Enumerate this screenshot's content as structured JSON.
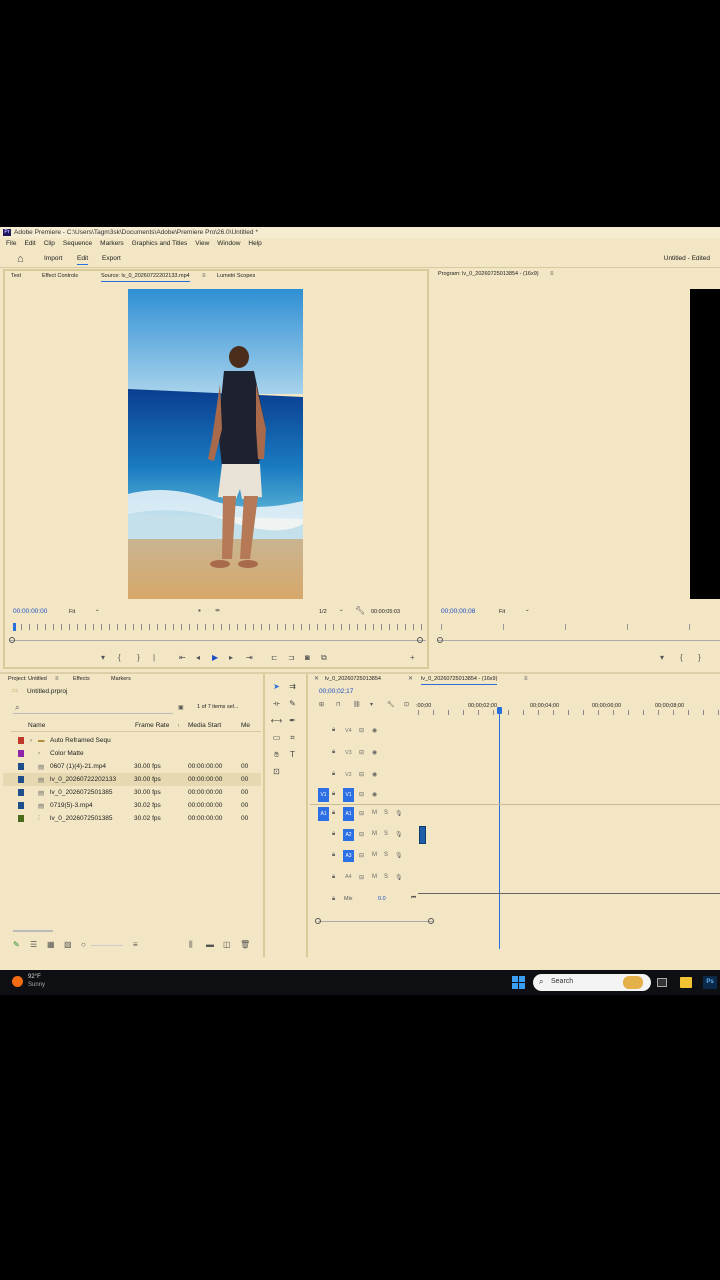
{
  "titlebar": {
    "logo": "Pr",
    "text": "Adobe Premiere - C:\\Users\\Tagm3sk\\Documents\\Adobe\\Premiere Pro\\26.0\\Untitled *"
  },
  "menu": [
    "File",
    "Edit",
    "Clip",
    "Sequence",
    "Markers",
    "Graphics and Titles",
    "View",
    "Window",
    "Help"
  ],
  "nav": {
    "import": "Import",
    "edit": "Edit",
    "export": "Export",
    "project_status": "Untitled - Edited"
  },
  "source_panel": {
    "tabs": [
      "Text",
      "Effect Controls",
      "Source: lv_0_20260722202133.mp4",
      "Lumetri Scopes"
    ],
    "timecode_left": "00:00:00:00",
    "fit": "Fit",
    "resolution": "1/2",
    "timecode_right": "00:00:05:03"
  },
  "program_panel": {
    "title": "Program: lv_0_20260725013854 - (16x9)",
    "timecode": "00;00;00;08",
    "fit": "Fit"
  },
  "project_panel": {
    "tabs": [
      "Project: Untitled",
      "Effects",
      "Markers"
    ],
    "file": "Untitled.prproj",
    "selection_count": "1 of 7 items sel...",
    "columns": {
      "name": "Name",
      "frame_rate": "Frame Rate",
      "media_start": "Media Start",
      "more": "Me"
    },
    "items": [
      {
        "color": "#c0392b",
        "name": "Auto Reframed Sequ",
        "fps": "",
        "start": "",
        "extra": "",
        "kind": "folder"
      },
      {
        "color": "#8e24aa",
        "name": "Color Matte",
        "fps": "",
        "start": "",
        "extra": "",
        "kind": "matte"
      },
      {
        "color": "#1f4e8c",
        "name": "0607 (1)(4)-21.mp4",
        "fps": "30.00 fps",
        "start": "00:00:00:00",
        "extra": "00",
        "kind": "clip"
      },
      {
        "color": "#1f4e8c",
        "name": "lv_0_20260722202133",
        "fps": "30.00 fps",
        "start": "00:00:00:00",
        "extra": "00",
        "kind": "clip"
      },
      {
        "color": "#1f4e8c",
        "name": "lv_0_2026072501385",
        "fps": "30.00 fps",
        "start": "00:00:00:00",
        "extra": "00",
        "kind": "clip"
      },
      {
        "color": "#1f4e8c",
        "name": "0719(5)-3.mp4",
        "fps": "30.02 fps",
        "start": "00:00:00:00",
        "extra": "00",
        "kind": "clip"
      },
      {
        "color": "#4a6b1a",
        "name": "lv_0_2026072501385",
        "fps": "30.02 fps",
        "start": "00:00:00:00",
        "extra": "00",
        "kind": "sequence"
      }
    ]
  },
  "timeline": {
    "tabs": [
      "lv_0_20260725013854",
      "lv_0_20260725013854 - (16x9)"
    ],
    "timecode": "00;00;02;17",
    "ruler": [
      ":00;00",
      "00;00;02;00",
      "00;00;04;00",
      "00;00;06;00",
      "00;00;08;00"
    ],
    "video_tracks": [
      "V4",
      "V3",
      "V2",
      "V1"
    ],
    "audio_tracks": [
      "A1",
      "A2",
      "A3",
      "A4"
    ],
    "mix_label": "Mix",
    "mix_value": "0.0"
  },
  "taskbar": {
    "temperature": "92°F",
    "weather": "Sunny",
    "search": "Search"
  },
  "colors": {
    "accent": "#2a6fdb",
    "panel_bg": "#f2e6c4",
    "track_button": "#2d6fe4"
  }
}
